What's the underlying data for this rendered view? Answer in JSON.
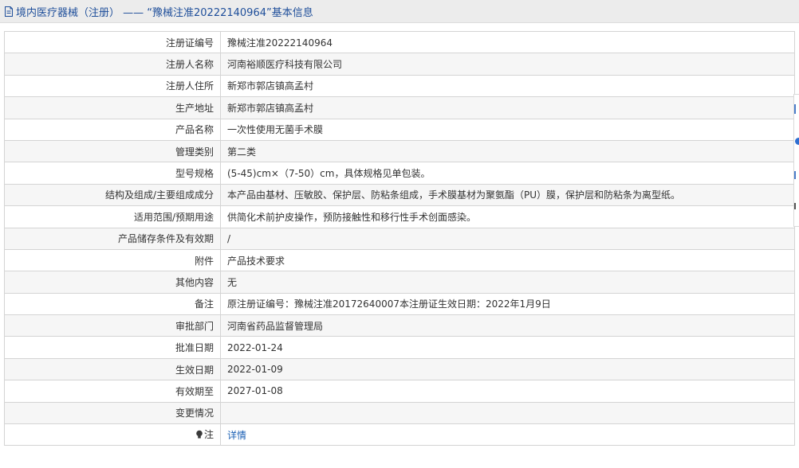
{
  "header": {
    "title": "境内医疗器械（注册） —— “豫械注准20222140964”基本信息"
  },
  "rows": [
    {
      "label": "注册证编号",
      "value": "豫械注准20222140964"
    },
    {
      "label": "注册人名称",
      "value": "河南裕顺医疗科技有限公司"
    },
    {
      "label": "注册人住所",
      "value": "新郑市郭店镇高孟村"
    },
    {
      "label": "生产地址",
      "value": "新郑市郭店镇高孟村"
    },
    {
      "label": "产品名称",
      "value": "一次性使用无菌手术膜"
    },
    {
      "label": "管理类别",
      "value": "第二类"
    },
    {
      "label": "型号规格",
      "value": "(5-45)cm×（7-50）cm，具体规格见单包装。"
    },
    {
      "label": "结构及组成/主要组成成分",
      "value": "本产品由基材、压敏胶、保护层、防粘条组成，手术膜基材为聚氨酯（PU）膜，保护层和防粘条为离型纸。"
    },
    {
      "label": "适用范围/预期用途",
      "value": "供简化术前护皮操作，预防接触性和移行性手术创面感染。"
    },
    {
      "label": "产品储存条件及有效期",
      "value": "/"
    },
    {
      "label": "附件",
      "value": "产品技术要求"
    },
    {
      "label": "其他内容",
      "value": "无"
    },
    {
      "label": "备注",
      "value": "原注册证编号：豫械注准20172640007本注册证生效日期：2022年1月9日"
    },
    {
      "label": "审批部门",
      "value": "河南省药品监督管理局"
    },
    {
      "label": "批准日期",
      "value": "2022-01-24"
    },
    {
      "label": "生效日期",
      "value": "2022-01-09"
    },
    {
      "label": "有效期至",
      "value": "2027-01-08"
    },
    {
      "label": "变更情况",
      "value": ""
    }
  ],
  "note_row": {
    "label": "注",
    "link": "详情",
    "icon": "lightbulb-icon"
  },
  "colors": {
    "header_text": "#1e4e9a",
    "link": "#1a5fb4",
    "border": "#d4d4d4",
    "row_alt": "#f6f6f6"
  }
}
